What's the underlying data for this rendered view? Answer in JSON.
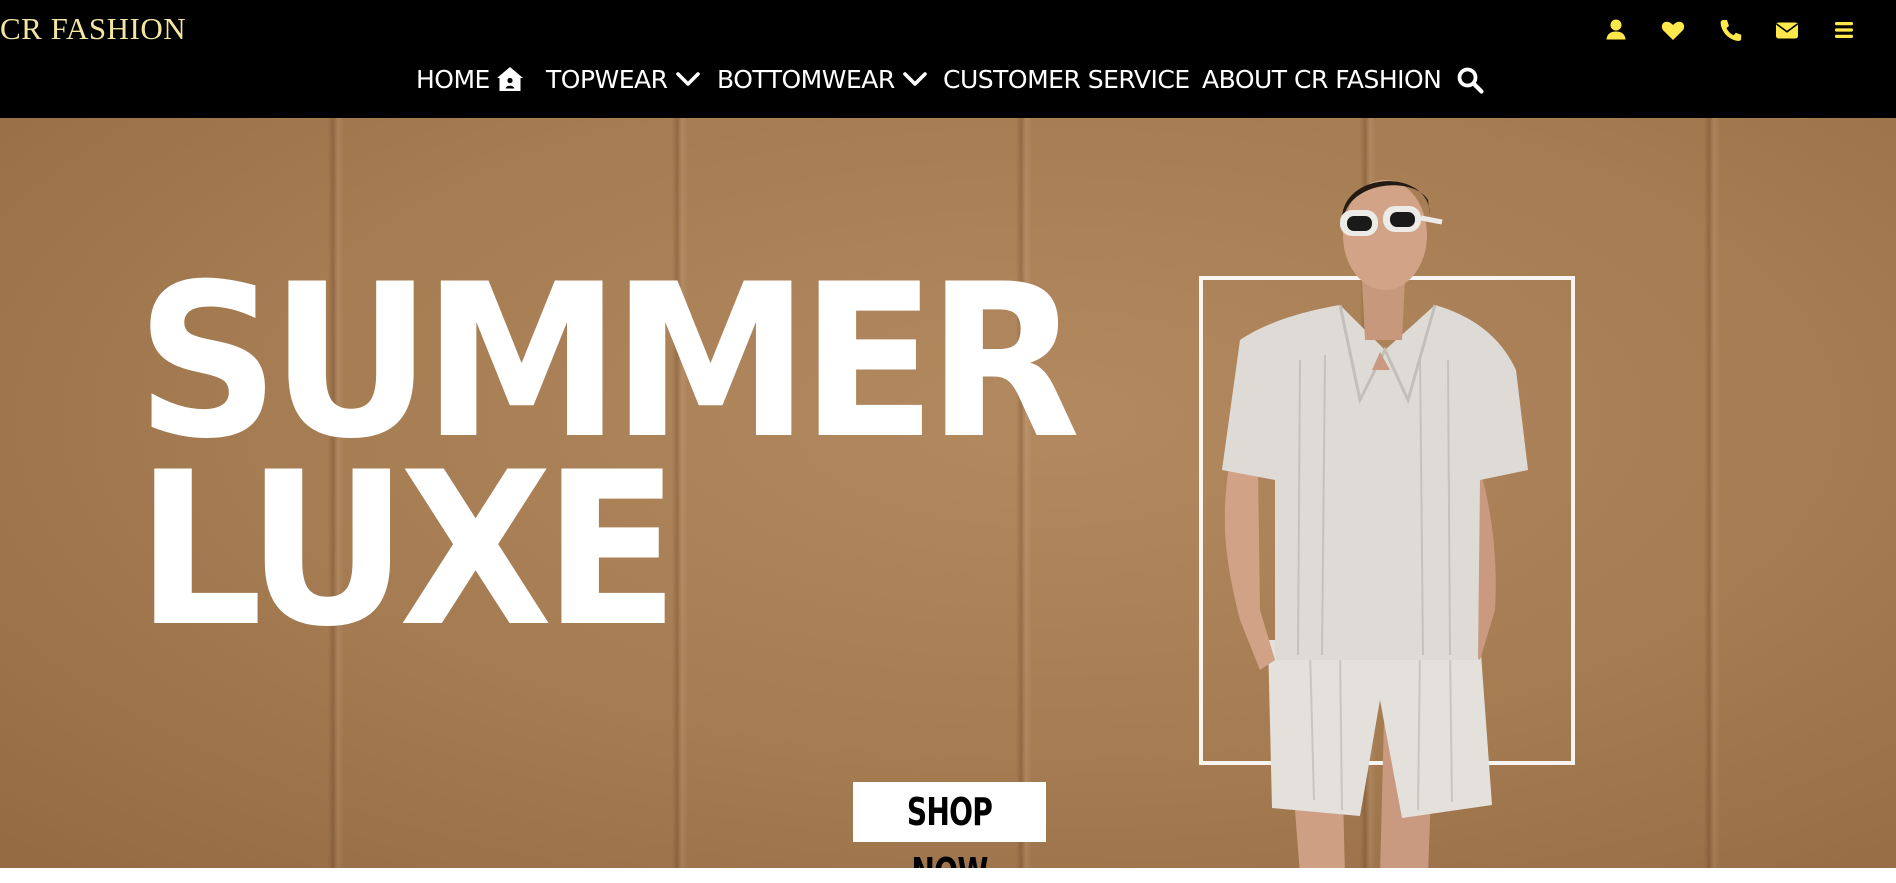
{
  "brand": {
    "name": "CR FASHION",
    "color": "#f2e6a0"
  },
  "header_icons": [
    {
      "icon": "user-icon",
      "color": "#ffe94a"
    },
    {
      "icon": "heart-icon",
      "color": "#ffe94a"
    },
    {
      "icon": "phone-icon",
      "color": "#ffe94a"
    },
    {
      "icon": "envelope-icon",
      "color": "#ffe94a"
    },
    {
      "icon": "menu-icon",
      "color": "#ffe94a"
    }
  ],
  "nav": {
    "items": [
      {
        "label": "HOME",
        "icon": "home-icon"
      },
      {
        "label": "TOPWEAR",
        "icon": "chevron-down-icon"
      },
      {
        "label": "BOTTOMWEAR",
        "icon": "chevron-down-icon"
      },
      {
        "label": "CUSTOMER SERVICE"
      },
      {
        "label": "ABOUT CR FASHION"
      }
    ],
    "search_icon": "search-icon"
  },
  "hero": {
    "headline_line1": "SUMMER",
    "headline_line2": "LUXE",
    "cta_label": "SHOP NOW",
    "background_color": "#a57b52"
  }
}
